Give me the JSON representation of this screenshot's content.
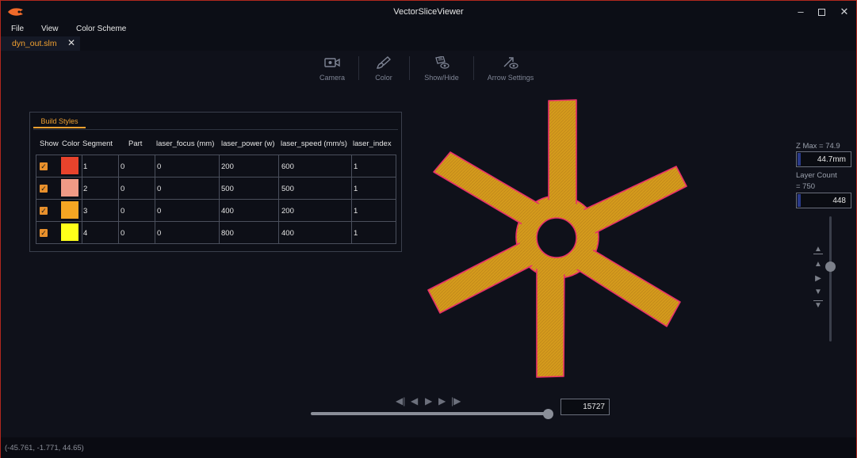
{
  "window": {
    "title": "VectorSliceViewer"
  },
  "menu": {
    "file": "File",
    "view": "View",
    "color_scheme": "Color Scheme"
  },
  "tabs": [
    {
      "label": "dyn_out.slm"
    }
  ],
  "toolbar": {
    "camera": "Camera",
    "color": "Color",
    "show_hide": "Show/Hide",
    "arrow_settings": "Arrow Settings"
  },
  "build_styles": {
    "tab_label": "Build Styles",
    "headers": [
      "Show",
      "Color",
      "Segment",
      "Part",
      "laser_focus (mm)",
      "laser_power (w)",
      "laser_speed (mm/s)",
      "laser_index"
    ],
    "rows": [
      {
        "show": true,
        "color": "#e8432c",
        "segment": "1",
        "part": "0",
        "focus": "0",
        "power": "200",
        "speed": "600",
        "index": "1"
      },
      {
        "show": true,
        "color": "#f09a86",
        "segment": "2",
        "part": "0",
        "focus": "0",
        "power": "500",
        "speed": "500",
        "index": "1"
      },
      {
        "show": true,
        "color": "#f6a623",
        "segment": "3",
        "part": "0",
        "focus": "0",
        "power": "400",
        "speed": "200",
        "index": "1"
      },
      {
        "show": true,
        "color": "#ffff1a",
        "segment": "4",
        "part": "0",
        "focus": "0",
        "power": "800",
        "speed": "400",
        "index": "1"
      }
    ]
  },
  "side_panel": {
    "z_max_label": "Z Max = 74.9",
    "z_value": "44.7mm",
    "layer_count_label_1": "Layer Count",
    "layer_count_label_2": "= 750",
    "layer_value": "448"
  },
  "layer_slider": {
    "level": 0.6
  },
  "playback": {
    "frame": "15727",
    "progress": 0.98
  },
  "status": {
    "coords": "(-45.761, -1.771, 44.65)"
  },
  "colors": {
    "accent": "#f0a030",
    "part_fill": "#d49a1c",
    "part_outline": "#e8306a",
    "border": "#b0281e"
  }
}
